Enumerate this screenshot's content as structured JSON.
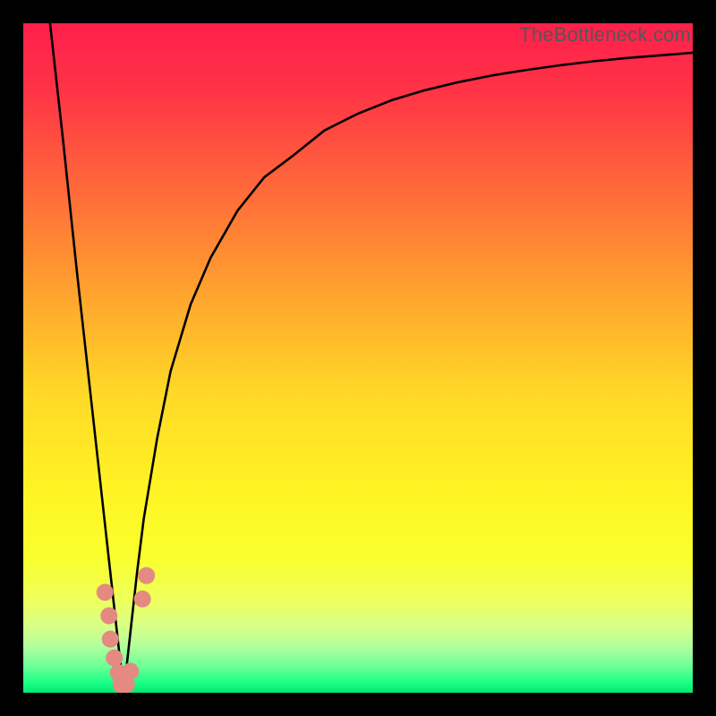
{
  "watermark": "TheBottleneck.com",
  "chart_data": {
    "type": "line",
    "title": "",
    "xlabel": "",
    "ylabel": "",
    "xlim": [
      0,
      100
    ],
    "ylim": [
      0,
      100
    ],
    "series": [
      {
        "name": "bottleneck-curve",
        "description": "V-shaped curve: steep linear descent from upper-left to a sharp minimum near x≈15, then a rapid rise that asymptotically flattens toward the upper-right",
        "x": [
          4,
          6,
          8,
          10,
          12,
          13,
          14,
          15,
          16,
          17,
          18,
          20,
          22,
          25,
          28,
          32,
          36,
          40,
          45,
          50,
          55,
          60,
          65,
          70,
          75,
          80,
          85,
          90,
          95,
          100
        ],
        "y": [
          100,
          82,
          63,
          45,
          27,
          18,
          9,
          0,
          9,
          18,
          26,
          38,
          48,
          58,
          65,
          72,
          77,
          80,
          84,
          86.5,
          88.5,
          90,
          91.2,
          92.2,
          93,
          93.7,
          94.3,
          94.8,
          95.2,
          95.6
        ]
      }
    ],
    "markers": {
      "name": "highlight-dots",
      "description": "Salmon-pink round markers clustered around the minimum",
      "points": [
        {
          "x": 12.2,
          "y": 15.0
        },
        {
          "x": 12.8,
          "y": 11.5
        },
        {
          "x": 13.0,
          "y": 8.0
        },
        {
          "x": 13.6,
          "y": 5.2
        },
        {
          "x": 14.2,
          "y": 3.0
        },
        {
          "x": 14.6,
          "y": 1.2
        },
        {
          "x": 15.4,
          "y": 1.2
        },
        {
          "x": 16.0,
          "y": 3.2
        },
        {
          "x": 17.8,
          "y": 14.0
        },
        {
          "x": 18.4,
          "y": 17.5
        }
      ],
      "color": "#e38a83"
    },
    "gradient_stops": [
      {
        "offset": 0.0,
        "color": "#ff1f4b"
      },
      {
        "offset": 0.1,
        "color": "#ff3346"
      },
      {
        "offset": 0.25,
        "color": "#ff6a3a"
      },
      {
        "offset": 0.4,
        "color": "#ffa22e"
      },
      {
        "offset": 0.55,
        "color": "#ffd827"
      },
      {
        "offset": 0.7,
        "color": "#fff423"
      },
      {
        "offset": 0.8,
        "color": "#f9ff2e"
      },
      {
        "offset": 0.86,
        "color": "#eeff5a"
      },
      {
        "offset": 0.9,
        "color": "#d8ff86"
      },
      {
        "offset": 0.93,
        "color": "#b3ff9c"
      },
      {
        "offset": 0.96,
        "color": "#6eff98"
      },
      {
        "offset": 0.985,
        "color": "#1aff85"
      },
      {
        "offset": 1.0,
        "color": "#00e874"
      }
    ]
  }
}
